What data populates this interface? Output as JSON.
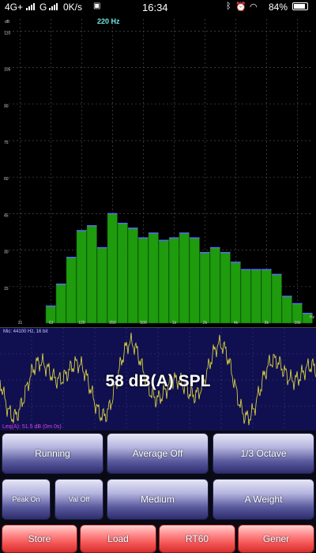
{
  "status": {
    "network": "4G+",
    "carrier2": "G",
    "speed": "0K/s",
    "time": "16:34",
    "battery": "84%"
  },
  "spectrum": {
    "peak_label": "220 Hz",
    "unit_label": "dB",
    "y_ticks": [
      "120",
      "105",
      "90",
      "75",
      "60",
      "45",
      "30",
      "15"
    ],
    "x_ticks": [
      "31",
      "63",
      "125",
      "250",
      "500",
      "1k",
      "2k",
      "4k",
      "8k",
      "16k"
    ],
    "x_unit": "Hz"
  },
  "chart_data": {
    "type": "bar",
    "title": "",
    "xlabel": "Hz",
    "ylabel": "dB",
    "ylim": [
      0,
      125
    ],
    "categories": [
      "25",
      "31.5",
      "40",
      "50",
      "63",
      "80",
      "100",
      "125",
      "160",
      "200",
      "250",
      "315",
      "400",
      "500",
      "630",
      "800",
      "1k",
      "1.25k",
      "1.6k",
      "2k",
      "2.5k",
      "3.15k",
      "4k",
      "5k",
      "6.3k",
      "8k",
      "10k",
      "12.5k",
      "16k",
      "20k"
    ],
    "values": [
      0,
      0,
      0,
      0,
      7,
      16,
      27,
      38,
      40,
      31,
      45,
      41,
      39,
      35,
      37,
      34,
      35,
      37,
      35,
      29,
      31,
      29,
      25,
      22,
      22,
      22,
      20,
      11,
      8,
      4
    ],
    "bar_color": "#1f9b0e",
    "grid": true
  },
  "waveform": {
    "info": "Mic: 44100 Hz, 16 bit",
    "spl_text": "58 dB(A) SPL",
    "leq_text": "Leq(A): 51.5 dB (0m 0s)"
  },
  "buttons": {
    "running": "Running",
    "average_off": "Average Off",
    "octave": "1/3 Octave",
    "peak_on": "Peak On",
    "val_off": "Val Off",
    "medium": "Medium",
    "a_weight": "A Weight",
    "store": "Store",
    "load": "Load",
    "rt60": "RT60",
    "gener": "Gener"
  }
}
